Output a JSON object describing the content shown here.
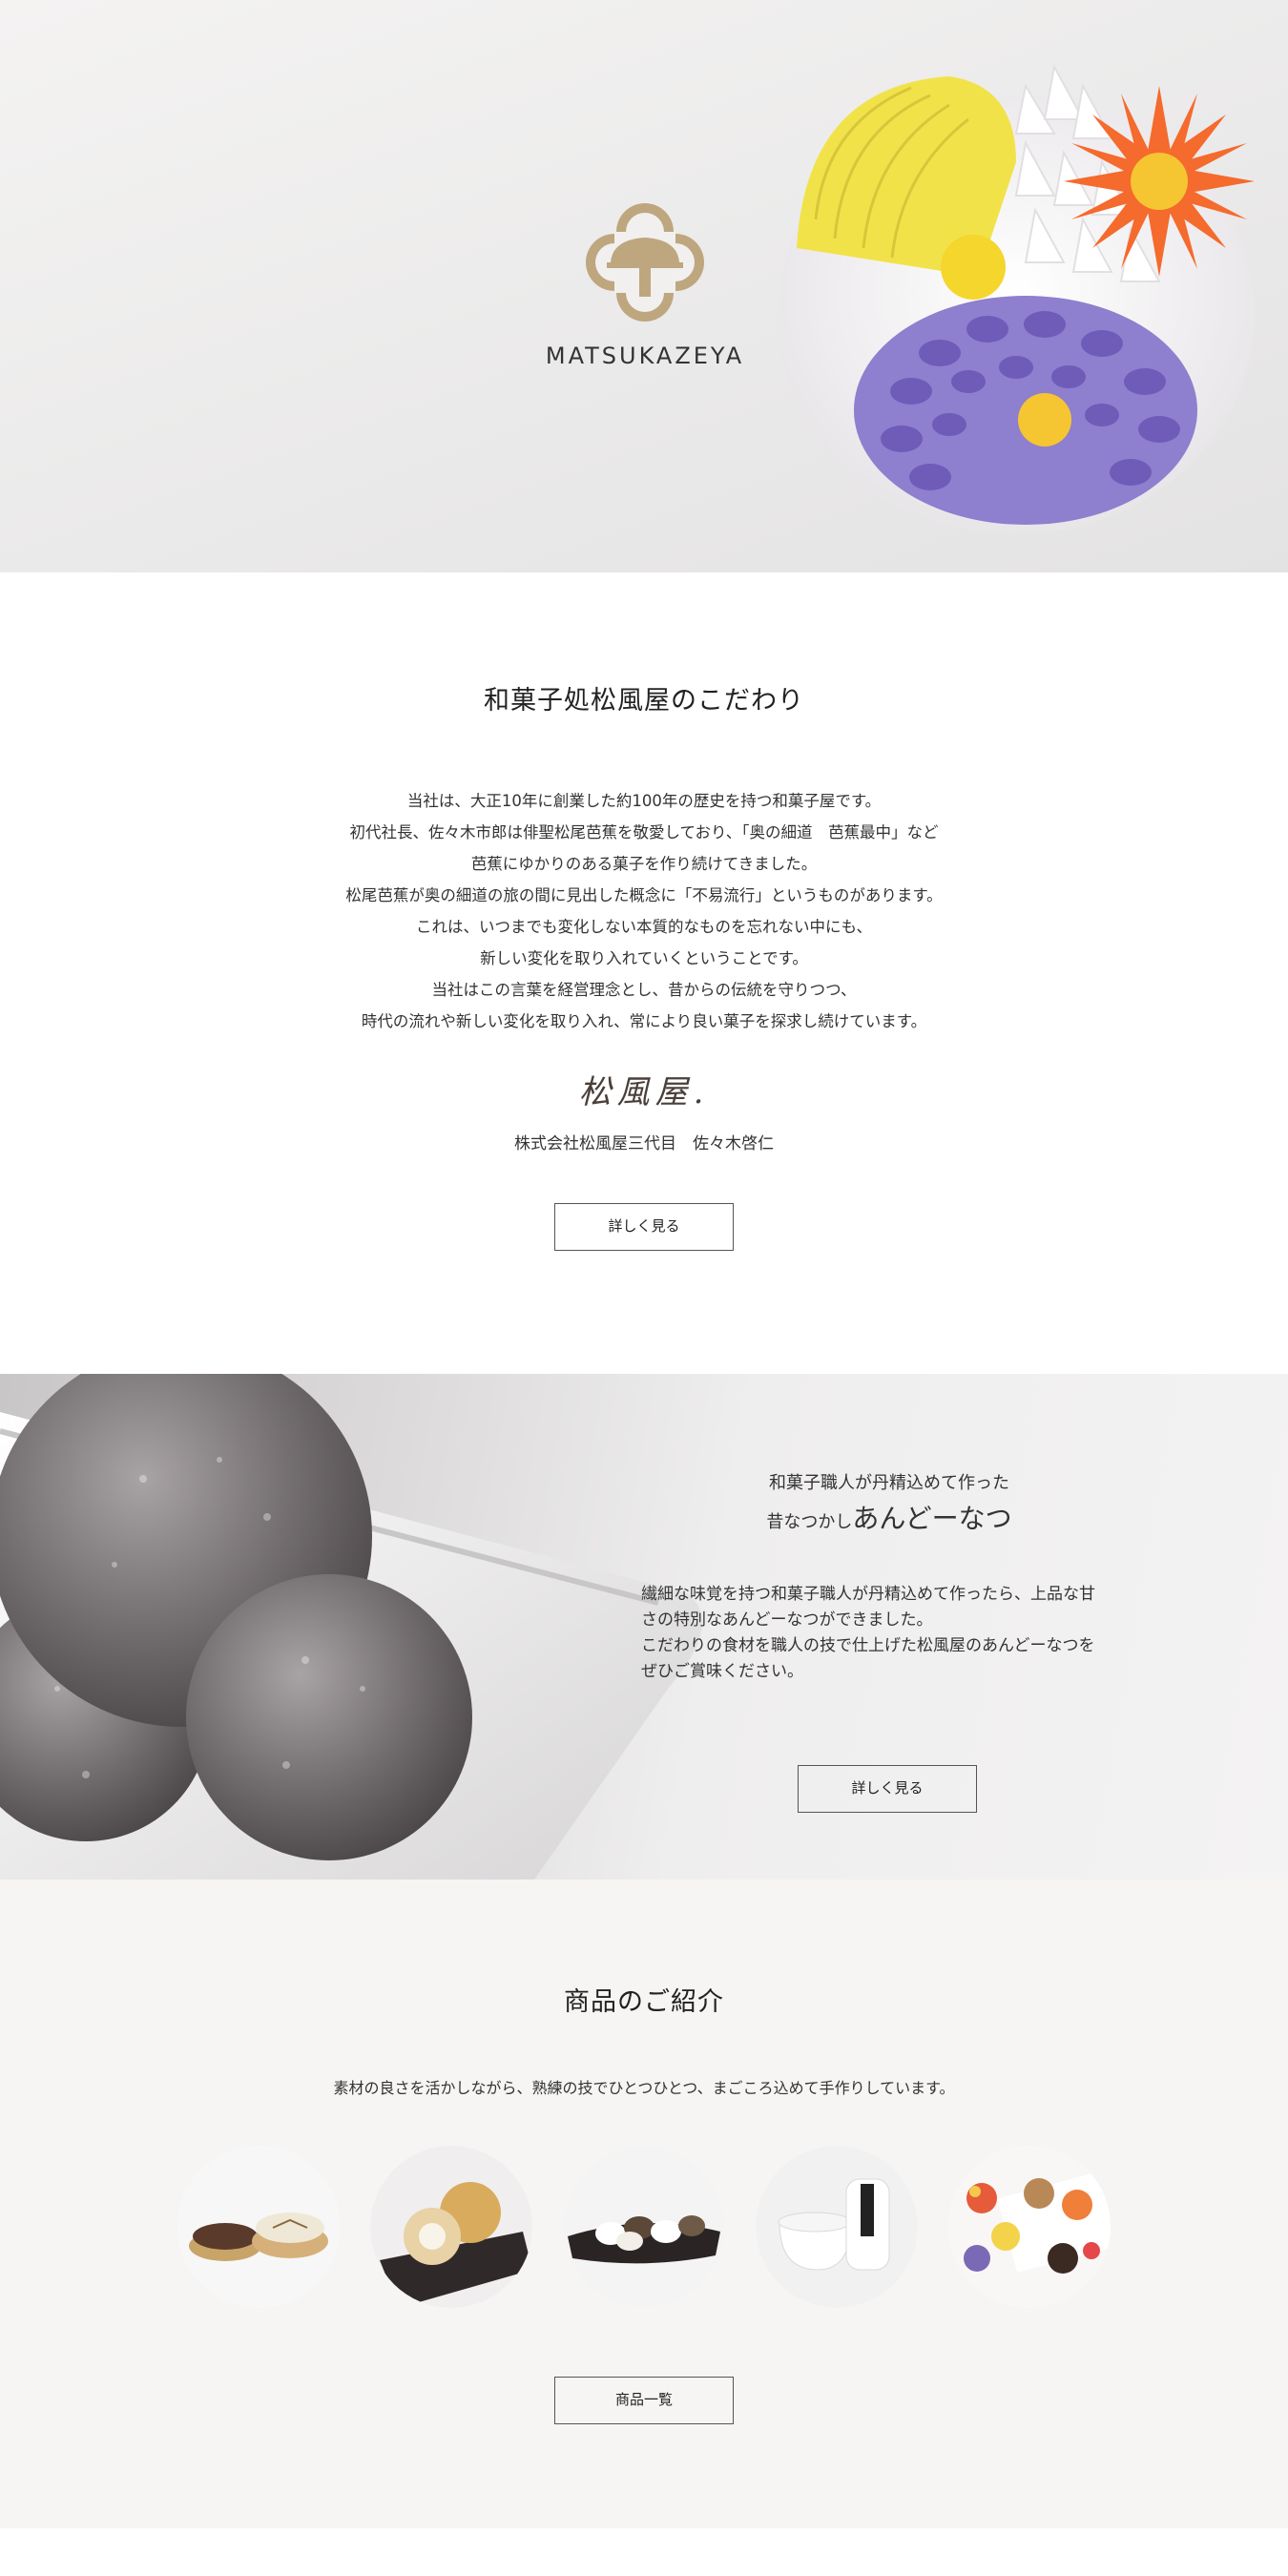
{
  "hero": {
    "brand": "MATSUKAZEYA",
    "colors": {
      "gold": "#bea67f",
      "yellow": "#f2e24a",
      "orange": "#f56a2d",
      "purple": "#6e5cb8"
    }
  },
  "kodawari": {
    "title": "和菓子処松風屋のこだわり",
    "paragraph": [
      "当社は、大正10年に創業した約100年の歴史を持つ和菓子屋です。",
      "初代社長、佐々木市郎は俳聖松尾芭蕉を敬愛しており、「奥の細道　芭蕉最中」など",
      "芭蕉にゆかりのある菓子を作り続けてきました。",
      "松尾芭蕉が奥の細道の旅の間に見出した概念に「不易流行」というものがあります。",
      "これは、いつまでも変化しない本質的なものを忘れない中にも、",
      "新しい変化を取り入れていくということです。",
      "当社はこの言葉を経営理念とし、昔からの伝統を守りつつ、",
      "時代の流れや新しい変化を取り入れ、常により良い菓子を探求し続けています。"
    ],
    "signature": "松風屋.",
    "signer": "株式会社松風屋三代目　佐々木啓仁",
    "button": "詳しく見る"
  },
  "donut": {
    "subtitle": "和菓子職人が丹精込めて作った",
    "heading_prefix": "昔なつかし",
    "heading_main": "あんどーなつ",
    "body": [
      "繊細な味覚を持つ和菓子職人が丹精込めて作ったら、上品な甘",
      "さの特別なあんどーなつができました。",
      "こだわりの食材を職人の技で仕上げた松風屋のあんどーなつを",
      "ぜひご賞味ください。"
    ],
    "button": "詳しく見る"
  },
  "products": {
    "title": "商品のご紹介",
    "lead": "素材の良さを活かしながら、熟練の技でひとつひとつ、まごころ込めて手作りしています。",
    "items": [
      "monaka-image",
      "mochi-image",
      "daifuku-image",
      "pudding-image",
      "namagashi-image"
    ],
    "button": "商品一覧"
  }
}
